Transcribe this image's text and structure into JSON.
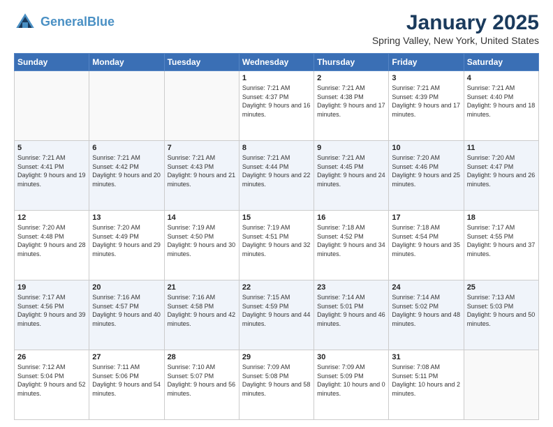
{
  "header": {
    "logo_line1": "General",
    "logo_line2": "Blue",
    "title": "January 2025",
    "subtitle": "Spring Valley, New York, United States"
  },
  "weekdays": [
    "Sunday",
    "Monday",
    "Tuesday",
    "Wednesday",
    "Thursday",
    "Friday",
    "Saturday"
  ],
  "weeks": [
    [
      {
        "day": "",
        "info": ""
      },
      {
        "day": "",
        "info": ""
      },
      {
        "day": "",
        "info": ""
      },
      {
        "day": "1",
        "info": "Sunrise: 7:21 AM\nSunset: 4:37 PM\nDaylight: 9 hours and 16 minutes."
      },
      {
        "day": "2",
        "info": "Sunrise: 7:21 AM\nSunset: 4:38 PM\nDaylight: 9 hours and 17 minutes."
      },
      {
        "day": "3",
        "info": "Sunrise: 7:21 AM\nSunset: 4:39 PM\nDaylight: 9 hours and 17 minutes."
      },
      {
        "day": "4",
        "info": "Sunrise: 7:21 AM\nSunset: 4:40 PM\nDaylight: 9 hours and 18 minutes."
      }
    ],
    [
      {
        "day": "5",
        "info": "Sunrise: 7:21 AM\nSunset: 4:41 PM\nDaylight: 9 hours and 19 minutes."
      },
      {
        "day": "6",
        "info": "Sunrise: 7:21 AM\nSunset: 4:42 PM\nDaylight: 9 hours and 20 minutes."
      },
      {
        "day": "7",
        "info": "Sunrise: 7:21 AM\nSunset: 4:43 PM\nDaylight: 9 hours and 21 minutes."
      },
      {
        "day": "8",
        "info": "Sunrise: 7:21 AM\nSunset: 4:44 PM\nDaylight: 9 hours and 22 minutes."
      },
      {
        "day": "9",
        "info": "Sunrise: 7:21 AM\nSunset: 4:45 PM\nDaylight: 9 hours and 24 minutes."
      },
      {
        "day": "10",
        "info": "Sunrise: 7:20 AM\nSunset: 4:46 PM\nDaylight: 9 hours and 25 minutes."
      },
      {
        "day": "11",
        "info": "Sunrise: 7:20 AM\nSunset: 4:47 PM\nDaylight: 9 hours and 26 minutes."
      }
    ],
    [
      {
        "day": "12",
        "info": "Sunrise: 7:20 AM\nSunset: 4:48 PM\nDaylight: 9 hours and 28 minutes."
      },
      {
        "day": "13",
        "info": "Sunrise: 7:20 AM\nSunset: 4:49 PM\nDaylight: 9 hours and 29 minutes."
      },
      {
        "day": "14",
        "info": "Sunrise: 7:19 AM\nSunset: 4:50 PM\nDaylight: 9 hours and 30 minutes."
      },
      {
        "day": "15",
        "info": "Sunrise: 7:19 AM\nSunset: 4:51 PM\nDaylight: 9 hours and 32 minutes."
      },
      {
        "day": "16",
        "info": "Sunrise: 7:18 AM\nSunset: 4:52 PM\nDaylight: 9 hours and 34 minutes."
      },
      {
        "day": "17",
        "info": "Sunrise: 7:18 AM\nSunset: 4:54 PM\nDaylight: 9 hours and 35 minutes."
      },
      {
        "day": "18",
        "info": "Sunrise: 7:17 AM\nSunset: 4:55 PM\nDaylight: 9 hours and 37 minutes."
      }
    ],
    [
      {
        "day": "19",
        "info": "Sunrise: 7:17 AM\nSunset: 4:56 PM\nDaylight: 9 hours and 39 minutes."
      },
      {
        "day": "20",
        "info": "Sunrise: 7:16 AM\nSunset: 4:57 PM\nDaylight: 9 hours and 40 minutes."
      },
      {
        "day": "21",
        "info": "Sunrise: 7:16 AM\nSunset: 4:58 PM\nDaylight: 9 hours and 42 minutes."
      },
      {
        "day": "22",
        "info": "Sunrise: 7:15 AM\nSunset: 4:59 PM\nDaylight: 9 hours and 44 minutes."
      },
      {
        "day": "23",
        "info": "Sunrise: 7:14 AM\nSunset: 5:01 PM\nDaylight: 9 hours and 46 minutes."
      },
      {
        "day": "24",
        "info": "Sunrise: 7:14 AM\nSunset: 5:02 PM\nDaylight: 9 hours and 48 minutes."
      },
      {
        "day": "25",
        "info": "Sunrise: 7:13 AM\nSunset: 5:03 PM\nDaylight: 9 hours and 50 minutes."
      }
    ],
    [
      {
        "day": "26",
        "info": "Sunrise: 7:12 AM\nSunset: 5:04 PM\nDaylight: 9 hours and 52 minutes."
      },
      {
        "day": "27",
        "info": "Sunrise: 7:11 AM\nSunset: 5:06 PM\nDaylight: 9 hours and 54 minutes."
      },
      {
        "day": "28",
        "info": "Sunrise: 7:10 AM\nSunset: 5:07 PM\nDaylight: 9 hours and 56 minutes."
      },
      {
        "day": "29",
        "info": "Sunrise: 7:09 AM\nSunset: 5:08 PM\nDaylight: 9 hours and 58 minutes."
      },
      {
        "day": "30",
        "info": "Sunrise: 7:09 AM\nSunset: 5:09 PM\nDaylight: 10 hours and 0 minutes."
      },
      {
        "day": "31",
        "info": "Sunrise: 7:08 AM\nSunset: 5:11 PM\nDaylight: 10 hours and 2 minutes."
      },
      {
        "day": "",
        "info": ""
      }
    ]
  ]
}
